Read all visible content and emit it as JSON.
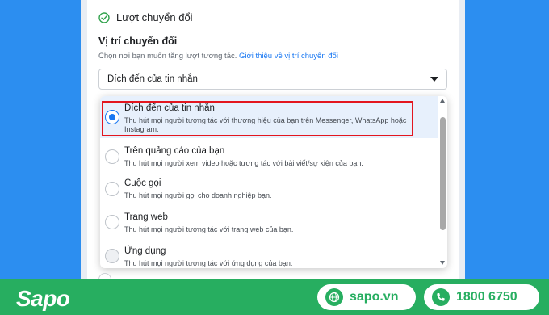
{
  "section": {
    "title": "Lượt chuyển đổi"
  },
  "field": {
    "label": "Vị trí chuyển đổi",
    "help": "Chọn nơi bạn muốn tăng lượt tương tác.",
    "help_link": "Giới thiệu về vị trí chuyển đổi"
  },
  "select": {
    "value": "Đích đến của tin nhắn"
  },
  "options": [
    {
      "title": "Đích đến của tin nhắn",
      "desc": "Thu hút mọi người tương tác với thương hiệu của bạn trên Messenger, WhatsApp hoặc Instagram.",
      "selected": true
    },
    {
      "title": "Trên quảng cáo của bạn",
      "desc": "Thu hút mọi người xem video hoặc tương tác với bài viết/sự kiện của bạn.",
      "selected": false
    },
    {
      "title": "Cuộc gọi",
      "desc": "Thu hút mọi người gọi cho doanh nghiệp bạn.",
      "selected": false
    },
    {
      "title": "Trang web",
      "desc": "Thu hút mọi người tương tác với trang web của bạn.",
      "selected": false
    },
    {
      "title": "Ứng dụng",
      "desc": "Thu hút mọi người tương tác với ứng dụng của bạn.",
      "selected": false
    }
  ],
  "footer": {
    "brand": "Sapo",
    "website": "sapo.vn",
    "phone": "1800 6750",
    "brand_color": "#27ae60"
  },
  "colors": {
    "accent": "#1877f2",
    "highlight": "#e3161f",
    "background": "#2c8ef0"
  },
  "icons": {
    "section": "check-circle-icon",
    "dropdown": "caret-down-icon",
    "website": "globe-icon",
    "phone": "phone-icon"
  }
}
